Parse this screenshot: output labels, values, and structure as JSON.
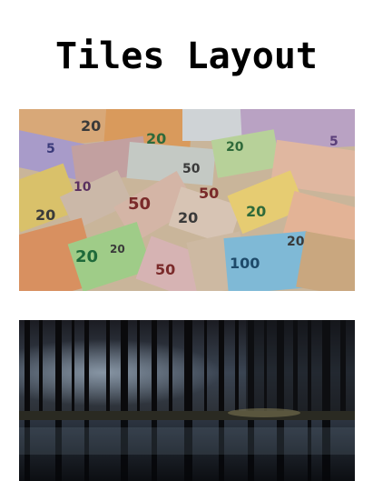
{
  "page": {
    "title": "Tiles Layout"
  },
  "tiles": [
    {
      "name": "banknotes-photo",
      "note_labels": [
        "20",
        "20",
        "5",
        "10",
        "20",
        "50",
        "50",
        "20",
        "20",
        "20",
        "50",
        "100",
        "5",
        "20",
        "20",
        "50",
        "20"
      ]
    },
    {
      "name": "forest-lake-photo"
    }
  ]
}
